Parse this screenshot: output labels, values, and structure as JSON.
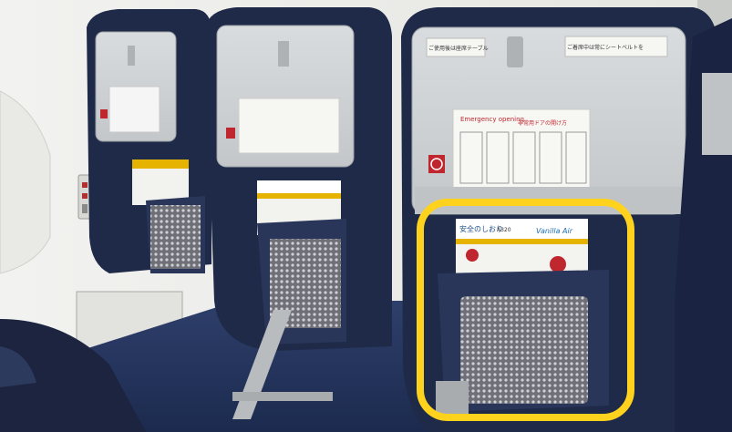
{
  "scene": {
    "description_type": "photo",
    "highlight_color": "#FFD21E",
    "seat_fabric_color": "#1f2a48",
    "tray_color": "#cfd2d4",
    "carpet_color": "#26365e"
  },
  "seats": [
    {
      "placard": {
        "title_en": "Emergency opening",
        "title_ja": "非常用ドアの開け方"
      },
      "tray_label_left": "ご使用後は座席テーブル",
      "tray_label_right": "ご着席中は常にシートベルトを",
      "pocket_card": {
        "title": "安全のしおり",
        "model": "A320",
        "brand": "Vanilla Air"
      },
      "highlighted": true
    }
  ]
}
